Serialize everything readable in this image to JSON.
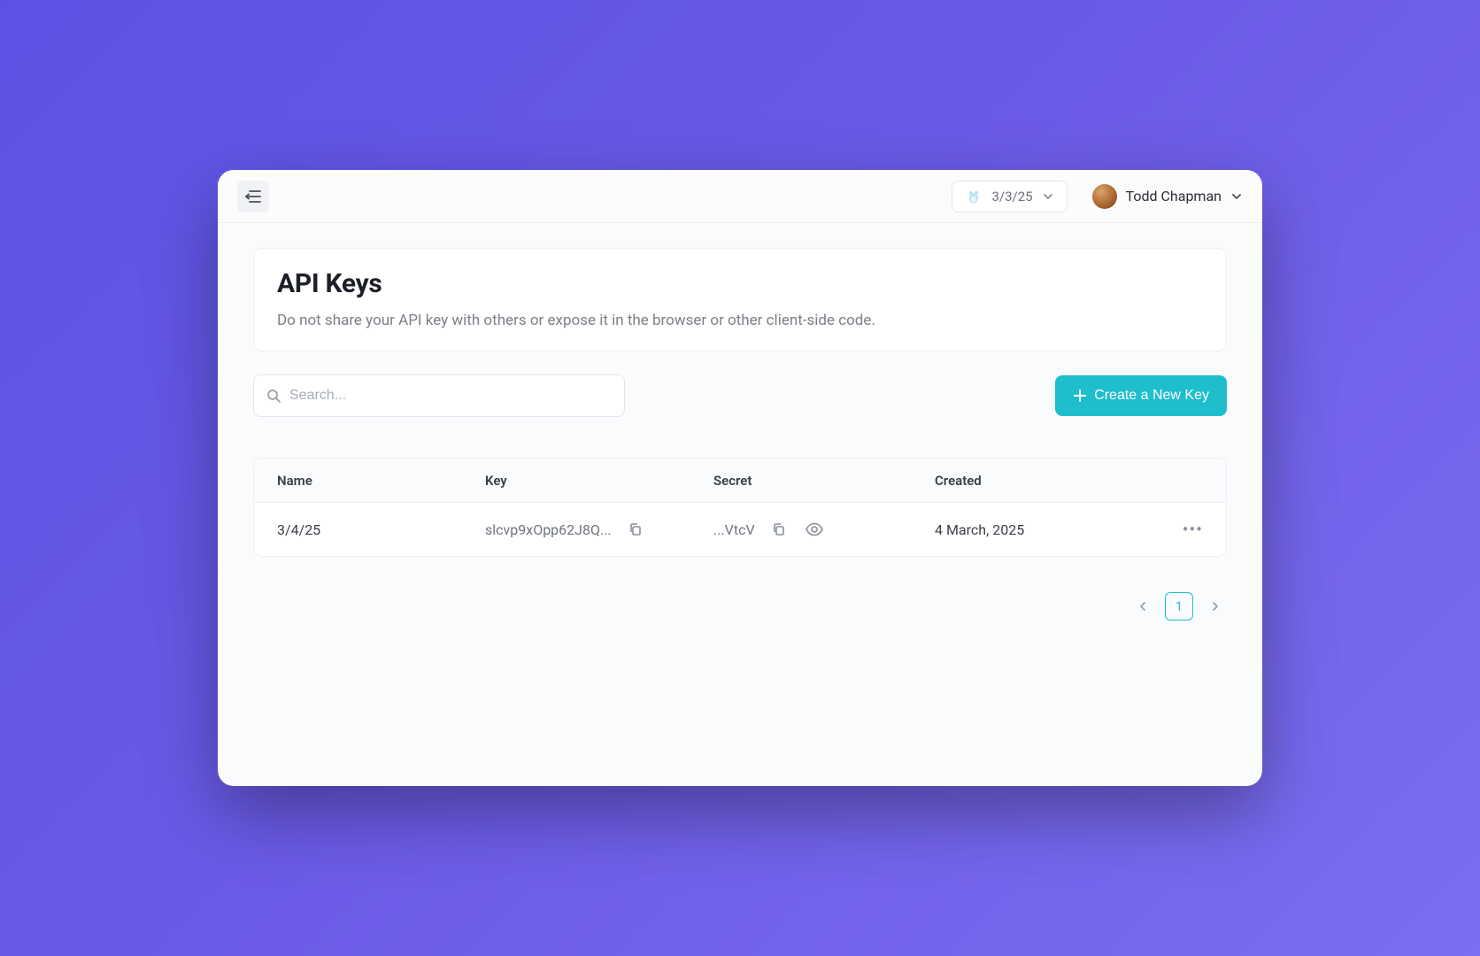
{
  "topbar": {
    "date_label": "3/3/25",
    "user_name": "Todd Chapman"
  },
  "page": {
    "title": "API Keys",
    "subtitle": "Do not share your API key with others or expose it in the browser or other client-side code."
  },
  "search": {
    "placeholder": "Search..."
  },
  "actions": {
    "create_label": "Create a New Key"
  },
  "table": {
    "headers": {
      "name": "Name",
      "key": "Key",
      "secret": "Secret",
      "created": "Created"
    },
    "rows": [
      {
        "name": "3/4/25",
        "key": "slcvp9xOpp62J8Q...",
        "secret": "...VtcV",
        "created": "4 March, 2025"
      }
    ]
  },
  "pagination": {
    "current": "1"
  },
  "colors": {
    "accent": "#1fbecd",
    "bg_gradient_start": "#5b52e5",
    "bg_gradient_end": "#7b6ef0"
  }
}
